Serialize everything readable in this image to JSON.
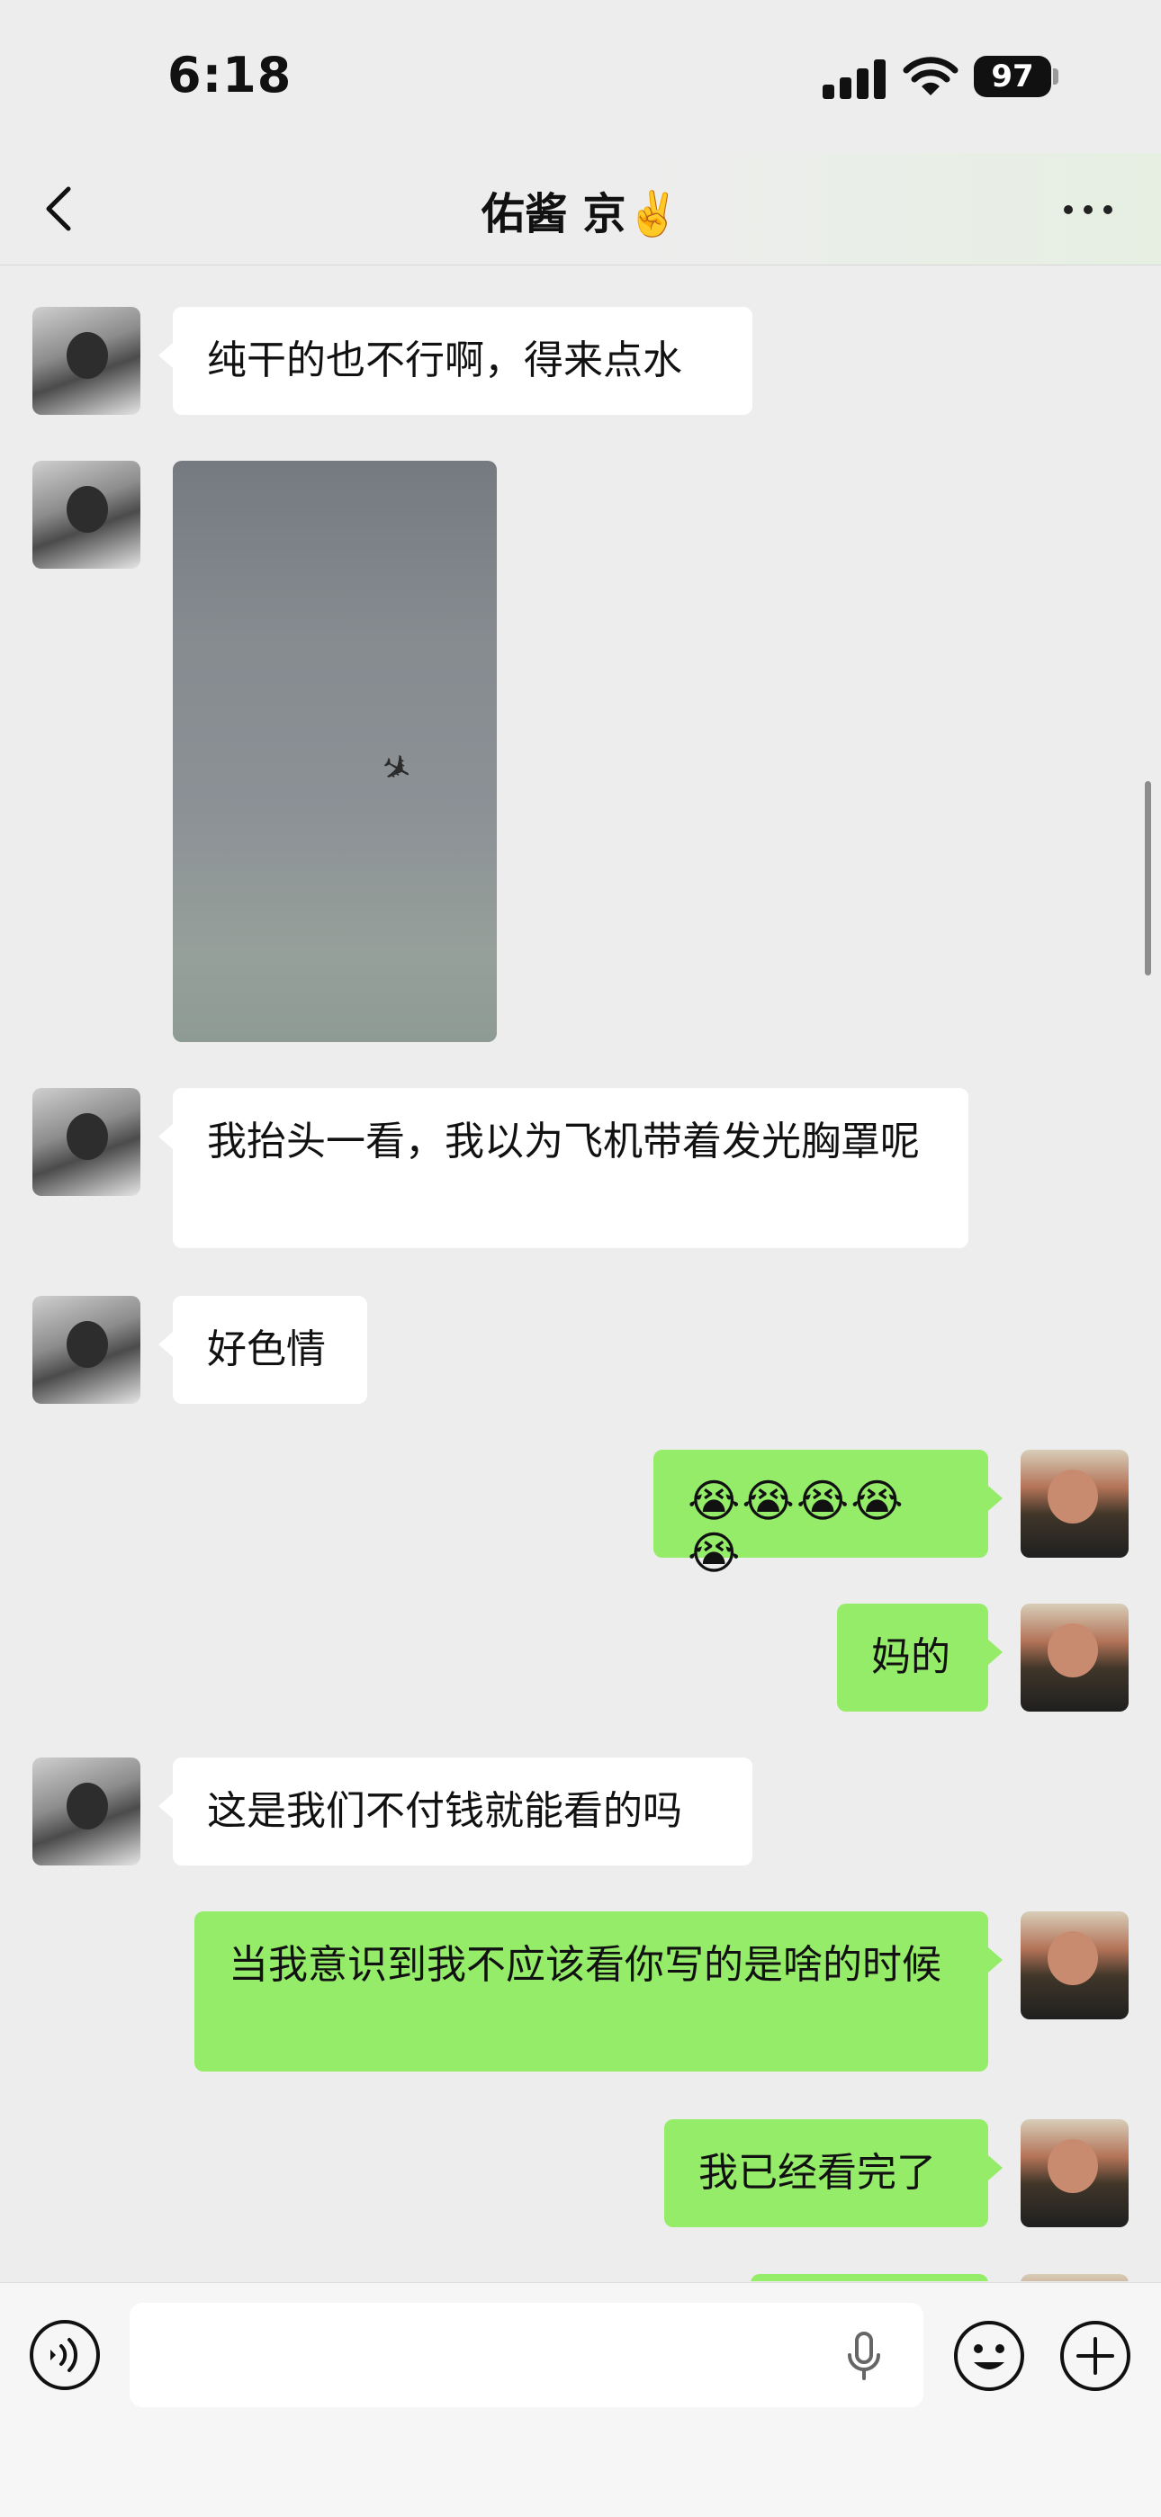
{
  "status_bar": {
    "time": "6:18",
    "battery": "97"
  },
  "nav": {
    "title": "佑酱 京✌️"
  },
  "messages": [
    {
      "side": "left",
      "text": "纯干的也不行啊，得来点水"
    },
    {
      "side": "left",
      "type": "image"
    },
    {
      "side": "left",
      "text": "我抬头一看，我以为飞机带着发光胸罩呢"
    },
    {
      "side": "left",
      "text": "好色情"
    },
    {
      "side": "right",
      "text": "😭😭😭😭😭"
    },
    {
      "side": "right",
      "text": "妈的"
    },
    {
      "side": "left",
      "text": "这是我们不付钱就能看的吗"
    },
    {
      "side": "right",
      "text": "当我意识到我不应该看你写的是啥的时候"
    },
    {
      "side": "right",
      "text": "我已经看完了"
    }
  ],
  "input": {
    "placeholder": ""
  },
  "icons": {
    "back": "chevron-left-icon",
    "more": "ellipsis-icon",
    "voice": "voice-icon",
    "mic": "microphone-icon",
    "emoji": "smiley-icon",
    "plus": "plus-icon"
  },
  "colors": {
    "sent_bubble": "#95ec69",
    "received_bubble": "#ffffff",
    "background": "#ededed"
  }
}
